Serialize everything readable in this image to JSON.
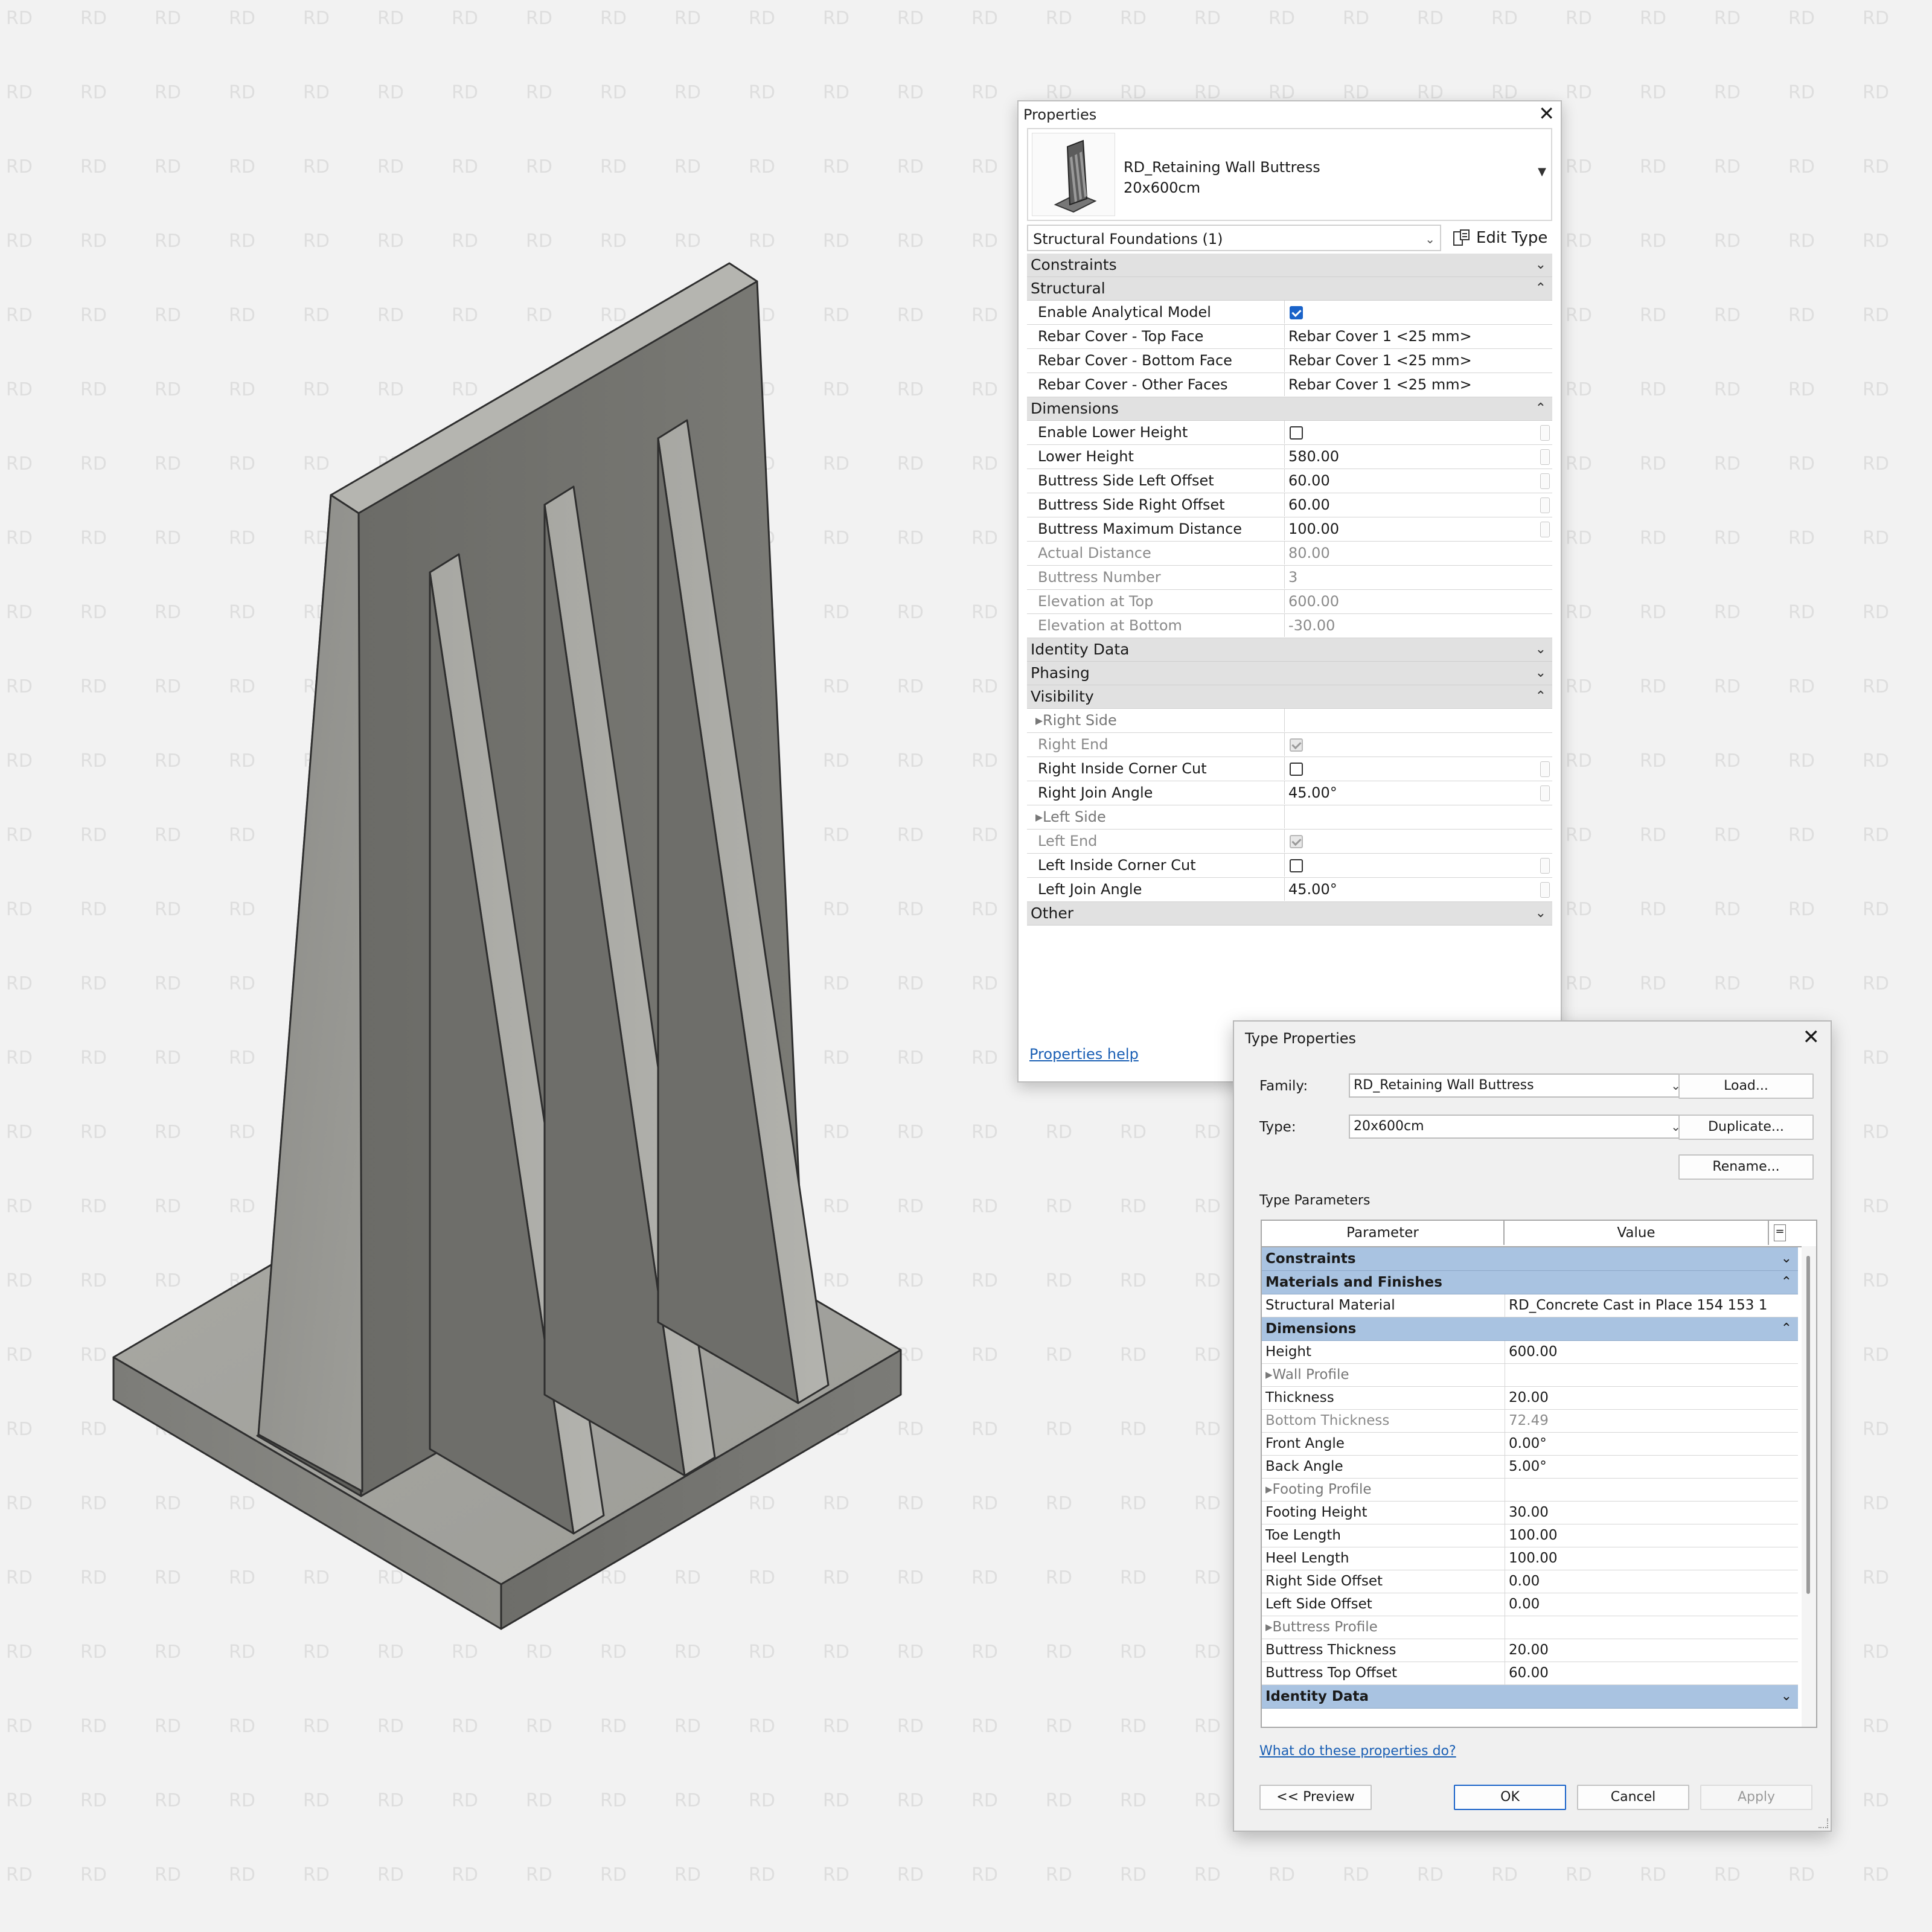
{
  "watermark": "RD",
  "properties": {
    "title": "Properties",
    "type_name_line1": "RD_Retaining Wall Buttress",
    "type_name_line2": "20x600cm",
    "category_selector": "Structural Foundations (1)",
    "edit_type_label": "Edit Type",
    "help_link": "Properties help",
    "groups": [
      {
        "name": "Constraints",
        "expanded": false,
        "rows": []
      },
      {
        "name": "Structural",
        "expanded": true,
        "rows": [
          {
            "label": "Enable Analytical Model",
            "checkbox": true,
            "checked": true
          },
          {
            "label": "Rebar Cover - Top Face",
            "value": "Rebar Cover 1 <25 mm>"
          },
          {
            "label": "Rebar Cover - Bottom Face",
            "value": "Rebar Cover 1 <25 mm>"
          },
          {
            "label": "Rebar Cover - Other Faces",
            "value": "Rebar Cover 1 <25 mm>"
          }
        ]
      },
      {
        "name": "Dimensions",
        "expanded": true,
        "rows": [
          {
            "label": "Enable Lower Height",
            "checkbox": true,
            "checked": false
          },
          {
            "label": "Lower Height",
            "value": "580.00"
          },
          {
            "label": "Buttress Side Left Offset",
            "value": "60.00"
          },
          {
            "label": "Buttress Side Right Offset",
            "value": "60.00"
          },
          {
            "label": "Buttress Maximum Distance",
            "value": "100.00"
          },
          {
            "label": "Actual Distance",
            "value": "80.00",
            "readonly": true
          },
          {
            "label": "Buttress Number",
            "value": "3",
            "readonly": true
          },
          {
            "label": "Elevation at Top",
            "value": "600.00",
            "readonly": true
          },
          {
            "label": "Elevation at Bottom",
            "value": "-30.00",
            "readonly": true
          }
        ]
      },
      {
        "name": "Identity Data",
        "expanded": false,
        "rows": []
      },
      {
        "name": "Phasing",
        "expanded": false,
        "rows": []
      },
      {
        "name": "Visibility",
        "expanded": true,
        "rows": [
          {
            "label": "Right Side",
            "subheader": true
          },
          {
            "label": "Right End",
            "checkbox": true,
            "checked": true,
            "readonly": true
          },
          {
            "label": "Right Inside Corner Cut",
            "checkbox": true,
            "checked": false
          },
          {
            "label": "Right Join Angle",
            "value": "45.00°"
          },
          {
            "label": "Left Side",
            "subheader": true
          },
          {
            "label": "Left End",
            "checkbox": true,
            "checked": true,
            "readonly": true
          },
          {
            "label": "Left Inside Corner Cut",
            "checkbox": true,
            "checked": false
          },
          {
            "label": "Left Join Angle",
            "value": "45.00°"
          }
        ]
      },
      {
        "name": "Other",
        "expanded": false,
        "rows": []
      }
    ]
  },
  "type_properties": {
    "title": "Type Properties",
    "family_label": "Family:",
    "family_value": "RD_Retaining Wall Buttress",
    "type_label": "Type:",
    "type_value": "20x600cm",
    "load_button": "Load...",
    "duplicate_button": "Duplicate...",
    "rename_button": "Rename...",
    "type_parameters_label": "Type Parameters",
    "col_parameter": "Parameter",
    "col_value": "Value",
    "col_eq": "=",
    "groups": [
      {
        "name": "Constraints",
        "expanded": false,
        "rows": []
      },
      {
        "name": "Materials and Finishes",
        "expanded": true,
        "rows": [
          {
            "label": "Structural Material",
            "value": "RD_Concrete Cast in Place 154 153 1"
          }
        ]
      },
      {
        "name": "Dimensions",
        "expanded": true,
        "rows": [
          {
            "label": "Height",
            "value": "600.00"
          },
          {
            "label": "Wall Profile",
            "subheader": true
          },
          {
            "label": "Thickness",
            "value": "20.00"
          },
          {
            "label": "Bottom Thickness",
            "value": "72.49",
            "readonly": true
          },
          {
            "label": "Front Angle",
            "value": "0.00°"
          },
          {
            "label": "Back Angle",
            "value": "5.00°"
          },
          {
            "label": "Footing Profile",
            "subheader": true
          },
          {
            "label": "Footing Height",
            "value": "30.00"
          },
          {
            "label": "Toe Length",
            "value": "100.00"
          },
          {
            "label": "Heel Length",
            "value": "100.00"
          },
          {
            "label": "Right Side Offset",
            "value": "0.00"
          },
          {
            "label": "Left Side Offset",
            "value": "0.00"
          },
          {
            "label": "Buttress Profile",
            "subheader": true
          },
          {
            "label": "Buttress Thickness",
            "value": "20.00"
          },
          {
            "label": "Buttress Top Offset",
            "value": "60.00"
          }
        ]
      },
      {
        "name": "Identity Data",
        "expanded": false,
        "rows": []
      }
    ],
    "help_link": "What do these properties do?",
    "preview_button": "<< Preview",
    "ok_button": "OK",
    "cancel_button": "Cancel",
    "apply_button": "Apply"
  }
}
